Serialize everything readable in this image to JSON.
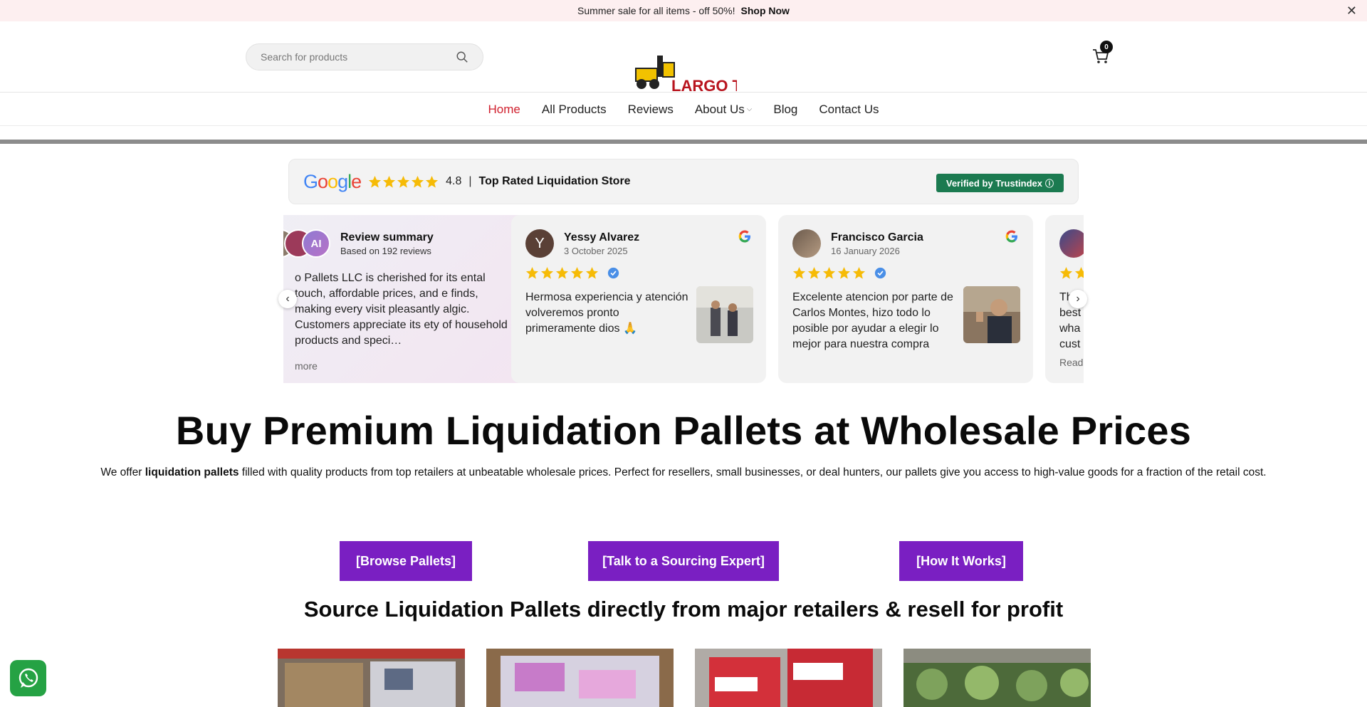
{
  "announcement": {
    "text": "Summer sale for all items - off 50%!",
    "cta": "Shop Now"
  },
  "header": {
    "search_placeholder": "Search for products",
    "logo_text": "LARGO T",
    "cart_count": "0"
  },
  "nav": {
    "items": [
      {
        "label": "Home",
        "active": true
      },
      {
        "label": "All Products"
      },
      {
        "label": "Reviews"
      },
      {
        "label": "About Us"
      },
      {
        "label": "Blog"
      },
      {
        "label": "Contact Us"
      }
    ]
  },
  "trust": {
    "brand": "Google",
    "rating": "4.8",
    "title": "Top Rated Liquidation Store",
    "verified": "Verified by Trustindex"
  },
  "reviews": [
    {
      "name": "Review summary",
      "date": "Based on 192 reviews",
      "text": "o Pallets LLC is cherished for its ental touch, affordable prices, and e finds, making every visit pleasantly algic. Customers appreciate its ety of household products and speci…",
      "readmore": "more",
      "ai_badge": "AI"
    },
    {
      "name": "Yessy Alvarez",
      "date": "3 October 2025",
      "initial": "Y",
      "text": "Hermosa experiencia y atención volveremos pronto primeramente dios 🙏"
    },
    {
      "name": "Francisco Garcia",
      "date": "16 January 2026",
      "text": "Excelente atencion por parte de Carlos Montes, hizo todo lo posible por ayudar a elegir lo mejor para nuestra compra"
    },
    {
      "text": "Th best wha cust",
      "readmore": "Read"
    }
  ],
  "hero": {
    "title": "Buy Premium Liquidation Pallets at Wholesale Prices",
    "sub_before": "We offer ",
    "sub_bold": "liquidation pallets",
    "sub_after": " filled with quality products from top retailers at unbeatable wholesale prices. Perfect for resellers, small businesses, or deal hunters, our pallets give you access to high-value goods for a fraction of the retail cost."
  },
  "ctas": [
    "[Browse Pallets]",
    "[Talk to a Sourcing Expert]",
    "[How It Works]"
  ],
  "section_title": "Source Liquidation Pallets directly from major retailers & resell for profit",
  "colors": {
    "accent": "#7a1fc2",
    "nav_active": "#d0202e",
    "verified": "#1b7a50",
    "star": "#f6bb06",
    "banner": "#fdeff0"
  }
}
